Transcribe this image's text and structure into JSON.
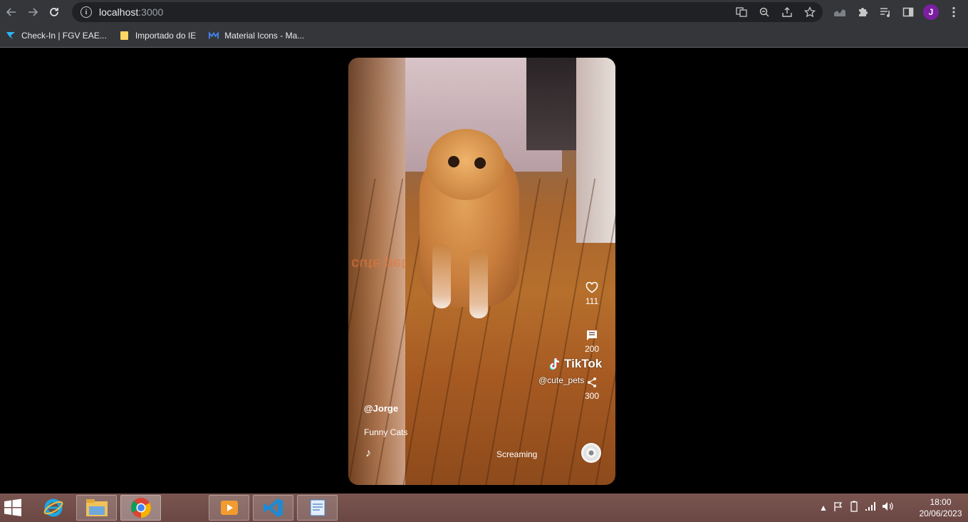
{
  "browser": {
    "url_host": "localhost",
    "url_port": ":3000",
    "profile_initial": "J",
    "bookmarks": [
      {
        "label": "Check-In | FGV EAE...",
        "icon": "fgv-icon"
      },
      {
        "label": "Importado do IE",
        "icon": "folder-icon"
      },
      {
        "label": "Material Icons - Ma...",
        "icon": "material-icon"
      }
    ]
  },
  "video": {
    "tiktok_brand": "TikTok",
    "tiktok_handle": "@cute_pets",
    "watermark": "cute pet",
    "likes": "111",
    "comments": "200",
    "shares": "300",
    "username": "@Jorge",
    "description": "Funny Cats",
    "song": "Screaming"
  },
  "taskbar": {
    "time": "18:00",
    "date": "20/06/2023"
  },
  "colors": {
    "chrome_bg": "#35363a",
    "omnibox_bg": "#202124",
    "avatar": "#7b1fa2",
    "taskbar": "#6b4744"
  }
}
